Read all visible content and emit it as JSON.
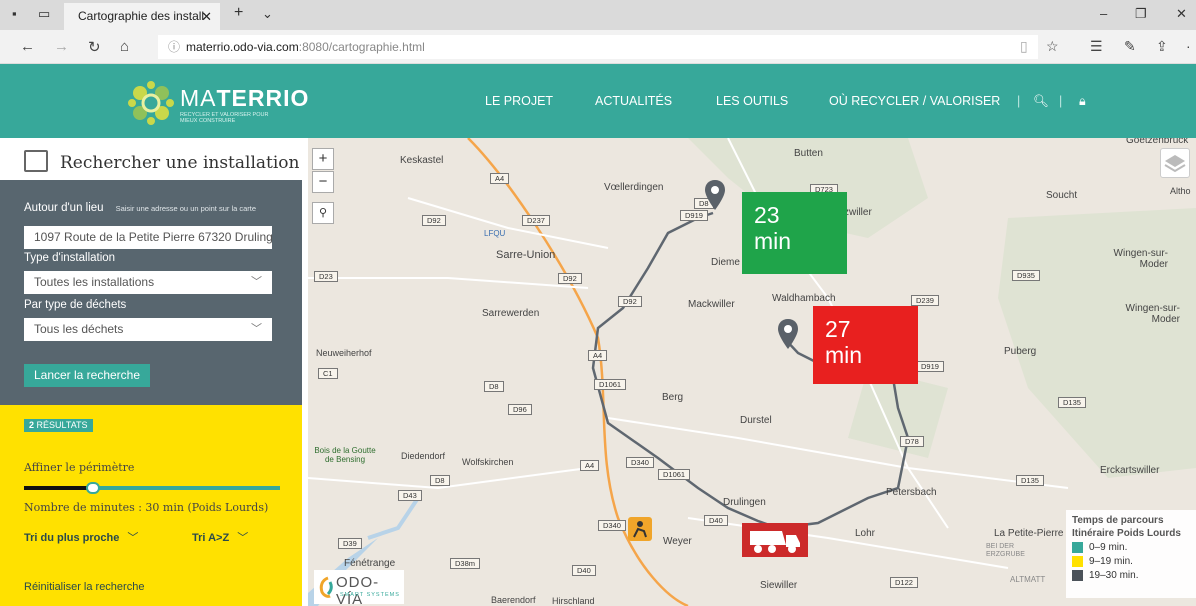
{
  "browser": {
    "tab_title": "Cartographie des install",
    "url_host": "materrio.odo-via.com",
    "url_port_path": ":8080/cartographie.html"
  },
  "site": {
    "brand_light": "MA",
    "brand_bold": "TERRIO",
    "tagline": "RECYCLER ET VALORISER POUR MIEUX CONSTRUIRE",
    "nav": [
      "LE PROJET",
      "ACTUALITÉS",
      "LES OUTILS",
      "OÙ RECYCLER / VALORISER"
    ]
  },
  "sidebar": {
    "title": "Rechercher une installation",
    "location_label": "Autour d'un lieu",
    "location_hint": "Saisir une adresse ou un point sur la carte",
    "location_value": "1097 Route de la Petite Pierre 67320 Drulinge",
    "type_label": "Type d'installation",
    "type_value": "Toutes les installations",
    "waste_label": "Par type de déchets",
    "waste_value": "Tous les déchets",
    "search_button": "Lancer la recherche",
    "results_count": "2",
    "results_label": "RÉSULTATS",
    "refine_label": "Affiner le périmètre",
    "slider_fraction": 0.27,
    "minutes_label": "Nombre de minutes : 30 min (Poids Lourds)",
    "sort_nearest": "Tri du plus proche",
    "sort_az": "Tri A>Z",
    "reset": "Réinitialiser la recherche"
  },
  "map": {
    "places": [
      "Keskastel",
      "Butten",
      "Vœllerdingen",
      "Goetzenbruck",
      "Soucht",
      "Altho",
      "LFQU",
      "Sarre-Union",
      "Dieme",
      "Wingen-sur-Moder",
      "Mackwiller",
      "Waldhambach",
      "Wingen-sur-Moder",
      "Sarrewerden",
      "Neuweiherhof",
      "Puberg",
      "Berg",
      "Durstel",
      "Bois de la Goutte de Bensing",
      "Diedendorf",
      "Wolfskirchen",
      "Erckartswiller",
      "Drulingen",
      "Petersbach",
      "Weyer",
      "Lohr",
      "La Petite-Pierre",
      "BEI DER ERZGRUBE",
      "Fénétrange",
      "ALTMATT",
      "Siewiller",
      "Baerendorf",
      "Hirschland",
      "zwiller"
    ],
    "roads": [
      "A4",
      "D723",
      "D8",
      "D92",
      "D237",
      "D919",
      "D935",
      "D23",
      "D92",
      "D92",
      "D239",
      "A4",
      "C1",
      "D1061",
      "D919",
      "D8",
      "D96",
      "D135",
      "D78",
      "D340",
      "D1061",
      "A4",
      "D8",
      "D43",
      "D135",
      "D340",
      "D40",
      "D39",
      "D38m",
      "D40",
      "D122"
    ],
    "times": [
      {
        "value": "23",
        "unit": "min",
        "color": "#1fa44a"
      },
      {
        "value": "27",
        "unit": "min",
        "color": "#e8201f"
      }
    ],
    "legend": {
      "title1": "Temps de parcours",
      "title2": "Itinéraire Poids Lourds",
      "items": [
        {
          "label": "0–9 min.",
          "color": "#37a89a"
        },
        {
          "label": "9–19 min.",
          "color": "#ffe100"
        },
        {
          "label": "19–30 min.",
          "color": "#4b5259"
        }
      ]
    },
    "attribution": {
      "logo": "ODO-VÍA",
      "sub": "SMART SYSTEMS"
    }
  }
}
